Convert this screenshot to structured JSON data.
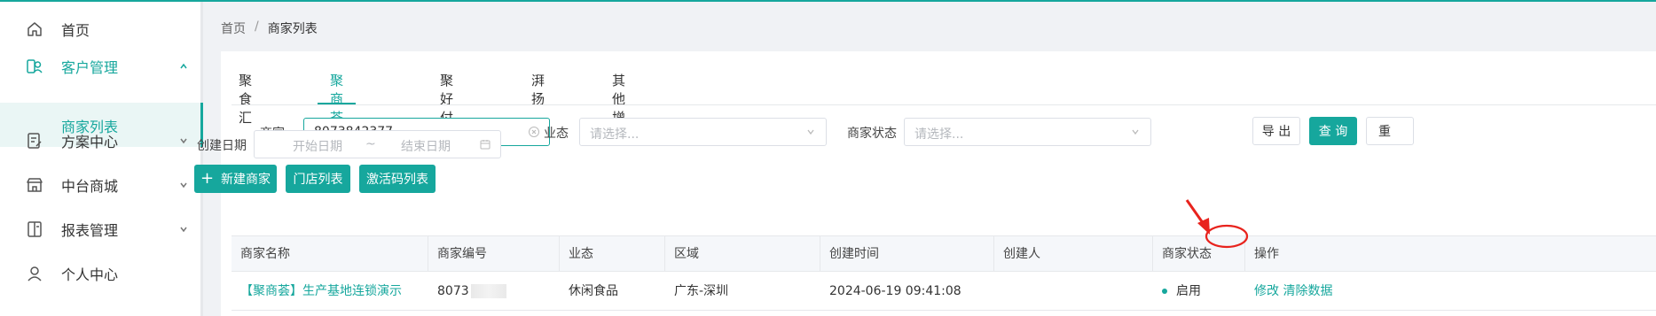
{
  "sidebar": {
    "items": [
      {
        "label": "首页",
        "icon": "home-icon"
      },
      {
        "label": "客户管理",
        "icon": "customers-icon",
        "expanded": true
      },
      {
        "label": "方案中心",
        "icon": "document-edit-icon"
      },
      {
        "label": "中台商城",
        "icon": "store-icon"
      },
      {
        "label": "报表管理",
        "icon": "report-icon"
      },
      {
        "label": "个人中心",
        "icon": "user-icon"
      }
    ],
    "sub_items": [
      {
        "label": "商家列表"
      }
    ]
  },
  "breadcrumb": {
    "items": [
      "首页",
      "商家列表"
    ],
    "separator": "/"
  },
  "tabs": [
    {
      "label": "聚食汇"
    },
    {
      "label": "聚商荟",
      "active": true
    },
    {
      "label": "聚好付"
    },
    {
      "label": "湃扬"
    },
    {
      "label": "其他增值"
    }
  ],
  "filters": {
    "merchant": {
      "label": "商家",
      "value": "8073842377"
    },
    "business_type": {
      "label": "业态",
      "placeholder": "请选择..."
    },
    "merchant_status": {
      "label": "商家状态",
      "placeholder": "请选择..."
    },
    "create_date": {
      "label": "创建日期",
      "start_placeholder": "开始日期",
      "range_separator": "~",
      "end_placeholder": "结束日期"
    }
  },
  "actions": {
    "export": "导 出",
    "query": "查 询",
    "reset": "重",
    "new_merchant": "新建商家",
    "store_list": "门店列表",
    "activation_code_list": "激活码列表"
  },
  "table": {
    "columns": [
      "商家名称",
      "商家编号",
      "业态",
      "区域",
      "创建时间",
      "创建人",
      "商家状态",
      "操作"
    ],
    "rows": [
      {
        "name": "【聚商荟】生产基地连锁演示",
        "number": "8073",
        "business_type": "休闲食品",
        "region": "广东-深圳",
        "created_at": "2024-06-19 09:41:08",
        "creator": "",
        "status": "启用",
        "action_edit": "修改",
        "action_clear": "清除数据"
      }
    ]
  },
  "colors": {
    "accent": "#16a79d",
    "annotation": "#e8231d"
  }
}
